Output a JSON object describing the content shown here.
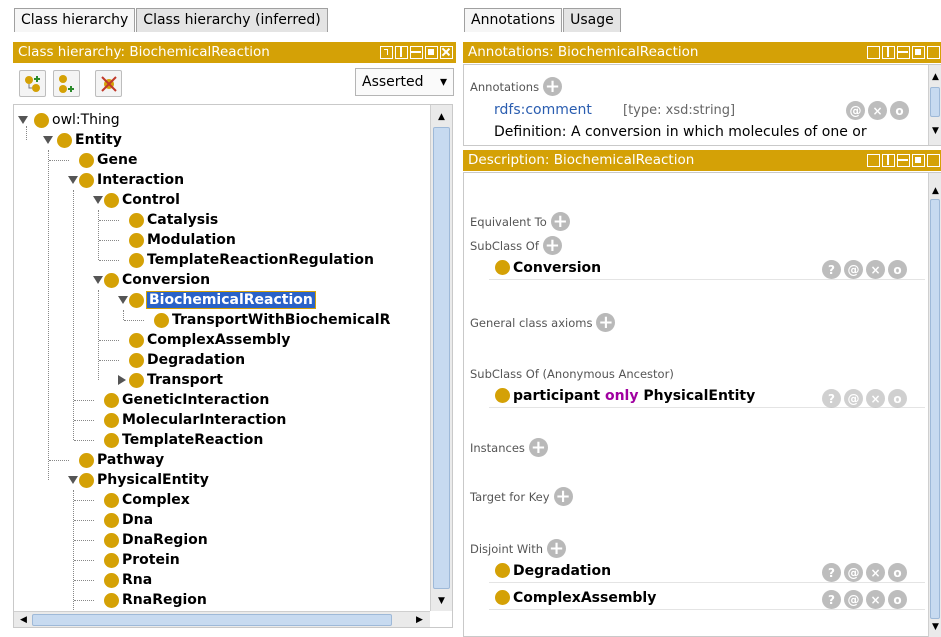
{
  "left_tabs": [
    "Class hierarchy",
    "Class hierarchy (inferred)"
  ],
  "right_tabs": [
    "Annotations",
    "Usage"
  ],
  "hierarchy_panel": {
    "title": "Class hierarchy: BiochemicalReaction",
    "mode_select": "Asserted",
    "mode_arrow": "▾"
  },
  "tree": {
    "root": "owl:Thing",
    "entity": "Entity",
    "gene": "Gene",
    "interaction": "Interaction",
    "control": "Control",
    "catalysis": "Catalysis",
    "modulation": "Modulation",
    "template_reaction_regulation": "TemplateReactionRegulation",
    "conversion": "Conversion",
    "biochemical_reaction": "BiochemicalReaction",
    "transport_with_br": "TransportWithBiochemicalR",
    "complex_assembly": "ComplexAssembly",
    "degradation": "Degradation",
    "transport": "Transport",
    "genetic_interaction": "GeneticInteraction",
    "molecular_interaction": "MolecularInteraction",
    "template_reaction": "TemplateReaction",
    "pathway": "Pathway",
    "physical_entity": "PhysicalEntity",
    "complex": "Complex",
    "dna": "Dna",
    "dna_region": "DnaRegion",
    "protein": "Protein",
    "rna": "Rna",
    "rna_region": "RnaRegion"
  },
  "annotations_panel": {
    "title": "Annotations: BiochemicalReaction",
    "section_label": "Annotations",
    "property": "rdfs:comment",
    "type": "[type: xsd:string]",
    "value": "Definition: A conversion in which molecules of one or"
  },
  "description_panel": {
    "title": "Description: BiochemicalReaction",
    "equivalent_to": "Equivalent To",
    "subclass_of": "SubClass Of",
    "subclass_value": "Conversion",
    "general_axioms": "General class axioms",
    "anon_ancestor": "SubClass Of (Anonymous Ancestor)",
    "anon_property": "participant",
    "anon_keyword": "only",
    "anon_filler": "PhysicalEntity",
    "instances": "Instances",
    "target_for_key": "Target for Key",
    "disjoint_with": "Disjoint With",
    "disjoint_1": "Degradation",
    "disjoint_2": "ComplexAssembly"
  },
  "action_glyphs": {
    "help": "?",
    "annotate": "@",
    "delete": "×",
    "edit": "o",
    "add": "+"
  },
  "colors": {
    "accent": "#d4a106",
    "keyword": "#a000a0",
    "selection": "#2a62c8",
    "link": "#2a5db0"
  }
}
